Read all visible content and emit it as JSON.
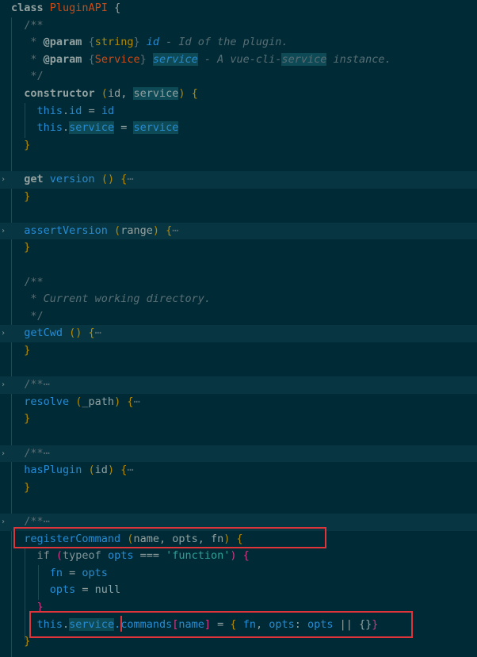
{
  "colors": {
    "default": "#93a1a1",
    "keyword": "#839496",
    "type": "#b58900",
    "function": "#268bd2",
    "comment": "#586e75",
    "string": "#2aa198",
    "paren": "#b58900",
    "bracket": "#d33682",
    "annotation": "#cb4b16",
    "match_bg": "#0e4a56",
    "fold_bg": "#073642",
    "red_box": "#e0343b"
  },
  "lines": [
    {
      "fold": false,
      "hl": false,
      "tokens": [
        {
          "t": "class ",
          "c": "default",
          "b": true
        },
        {
          "t": "PluginAPI",
          "c": "annotation"
        },
        {
          "t": " {",
          "c": "default"
        }
      ]
    },
    {
      "fold": false,
      "hl": false,
      "tokens": [
        {
          "t": "  /**",
          "c": "comment"
        }
      ]
    },
    {
      "fold": false,
      "hl": false,
      "tokens": [
        {
          "t": "   * ",
          "c": "comment"
        },
        {
          "t": "@param",
          "c": "default",
          "b": true
        },
        {
          "t": " {",
          "c": "comment"
        },
        {
          "t": "string",
          "c": "type"
        },
        {
          "t": "} ",
          "c": "comment"
        },
        {
          "t": "id",
          "c": "function",
          "i": true
        },
        {
          "t": " - Id of the plugin.",
          "c": "comment",
          "i": true
        }
      ]
    },
    {
      "fold": false,
      "hl": false,
      "tokens": [
        {
          "t": "   * ",
          "c": "comment"
        },
        {
          "t": "@param",
          "c": "default",
          "b": true
        },
        {
          "t": " {",
          "c": "comment"
        },
        {
          "t": "Service",
          "c": "annotation"
        },
        {
          "t": "} ",
          "c": "comment"
        },
        {
          "t": "service",
          "c": "function",
          "i": true,
          "m": true
        },
        {
          "t": " - A vue-cli-",
          "c": "comment",
          "i": true
        },
        {
          "t": "service",
          "c": "comment",
          "i": true,
          "m": true
        },
        {
          "t": " instance.",
          "c": "comment",
          "i": true
        }
      ]
    },
    {
      "fold": false,
      "hl": false,
      "tokens": [
        {
          "t": "   */",
          "c": "comment"
        }
      ]
    },
    {
      "fold": false,
      "hl": false,
      "tokens": [
        {
          "t": "  constructor",
          "c": "default",
          "b": true
        },
        {
          "t": " (",
          "c": "paren"
        },
        {
          "t": "id",
          "c": "default"
        },
        {
          "t": ", ",
          "c": "default"
        },
        {
          "t": "service",
          "c": "default",
          "m": true
        },
        {
          "t": ") {",
          "c": "paren"
        }
      ]
    },
    {
      "fold": false,
      "hl": false,
      "tokens": [
        {
          "t": "    this",
          "c": "function"
        },
        {
          "t": ".",
          "c": "default"
        },
        {
          "t": "id",
          "c": "function"
        },
        {
          "t": " = ",
          "c": "default"
        },
        {
          "t": "id",
          "c": "function"
        }
      ]
    },
    {
      "fold": false,
      "hl": false,
      "tokens": [
        {
          "t": "    this",
          "c": "function"
        },
        {
          "t": ".",
          "c": "default"
        },
        {
          "t": "service",
          "c": "function",
          "m": true
        },
        {
          "t": " = ",
          "c": "default"
        },
        {
          "t": "service",
          "c": "function",
          "m": true
        }
      ]
    },
    {
      "fold": false,
      "hl": false,
      "tokens": [
        {
          "t": "  }",
          "c": "paren"
        }
      ]
    },
    {
      "fold": false,
      "hl": false,
      "tokens": []
    },
    {
      "fold": true,
      "hl": true,
      "tokens": [
        {
          "t": "  get ",
          "c": "default",
          "b": true
        },
        {
          "t": "version",
          "c": "function"
        },
        {
          "t": " () {",
          "c": "paren"
        },
        {
          "t": "⋯",
          "c": "comment"
        }
      ]
    },
    {
      "fold": false,
      "hl": false,
      "tokens": [
        {
          "t": "  }",
          "c": "paren"
        }
      ]
    },
    {
      "fold": false,
      "hl": false,
      "tokens": []
    },
    {
      "fold": true,
      "hl": true,
      "tokens": [
        {
          "t": "  assertVersion",
          "c": "function"
        },
        {
          "t": " (",
          "c": "paren"
        },
        {
          "t": "range",
          "c": "default"
        },
        {
          "t": ") {",
          "c": "paren"
        },
        {
          "t": "⋯",
          "c": "comment"
        }
      ]
    },
    {
      "fold": false,
      "hl": false,
      "tokens": [
        {
          "t": "  }",
          "c": "paren"
        }
      ]
    },
    {
      "fold": false,
      "hl": false,
      "tokens": []
    },
    {
      "fold": false,
      "hl": false,
      "tokens": [
        {
          "t": "  /**",
          "c": "comment"
        }
      ]
    },
    {
      "fold": false,
      "hl": false,
      "tokens": [
        {
          "t": "   * Current working directory.",
          "c": "comment",
          "i": true
        }
      ]
    },
    {
      "fold": false,
      "hl": false,
      "tokens": [
        {
          "t": "   */",
          "c": "comment"
        }
      ]
    },
    {
      "fold": true,
      "hl": true,
      "tokens": [
        {
          "t": "  getCwd",
          "c": "function"
        },
        {
          "t": " () {",
          "c": "paren"
        },
        {
          "t": "⋯",
          "c": "comment"
        }
      ]
    },
    {
      "fold": false,
      "hl": false,
      "tokens": [
        {
          "t": "  }",
          "c": "paren"
        }
      ]
    },
    {
      "fold": false,
      "hl": false,
      "tokens": []
    },
    {
      "fold": true,
      "hl": true,
      "tokens": [
        {
          "t": "  /**",
          "c": "comment"
        },
        {
          "t": "⋯",
          "c": "comment"
        }
      ]
    },
    {
      "fold": false,
      "hl": false,
      "tokens": [
        {
          "t": "  resolve",
          "c": "function"
        },
        {
          "t": " (",
          "c": "paren"
        },
        {
          "t": "_path",
          "c": "default"
        },
        {
          "t": ") {",
          "c": "paren"
        },
        {
          "t": "⋯",
          "c": "comment"
        }
      ]
    },
    {
      "fold": false,
      "hl": false,
      "tokens": [
        {
          "t": "  }",
          "c": "paren"
        }
      ]
    },
    {
      "fold": false,
      "hl": false,
      "tokens": []
    },
    {
      "fold": true,
      "hl": true,
      "tokens": [
        {
          "t": "  /**",
          "c": "comment"
        },
        {
          "t": "⋯",
          "c": "comment"
        }
      ]
    },
    {
      "fold": false,
      "hl": false,
      "tokens": [
        {
          "t": "  hasPlugin",
          "c": "function"
        },
        {
          "t": " (",
          "c": "paren"
        },
        {
          "t": "id",
          "c": "default"
        },
        {
          "t": ") {",
          "c": "paren"
        },
        {
          "t": "⋯",
          "c": "comment"
        }
      ]
    },
    {
      "fold": false,
      "hl": false,
      "tokens": [
        {
          "t": "  }",
          "c": "paren"
        }
      ]
    },
    {
      "fold": false,
      "hl": false,
      "tokens": []
    },
    {
      "fold": true,
      "hl": true,
      "tokens": [
        {
          "t": "  /**",
          "c": "comment"
        },
        {
          "t": "⋯",
          "c": "comment"
        }
      ]
    },
    {
      "fold": false,
      "hl": false,
      "tokens": [
        {
          "t": "  registerCommand",
          "c": "function"
        },
        {
          "t": " (",
          "c": "paren"
        },
        {
          "t": "name",
          "c": "default"
        },
        {
          "t": ", ",
          "c": "default"
        },
        {
          "t": "opts",
          "c": "default"
        },
        {
          "t": ", ",
          "c": "default"
        },
        {
          "t": "fn",
          "c": "default"
        },
        {
          "t": ") {",
          "c": "paren"
        }
      ]
    },
    {
      "fold": false,
      "hl": false,
      "tokens": [
        {
          "t": "    if ",
          "c": "keyword"
        },
        {
          "t": "(",
          "c": "bracket"
        },
        {
          "t": "typeof ",
          "c": "keyword"
        },
        {
          "t": "opts",
          "c": "function"
        },
        {
          "t": " === ",
          "c": "default"
        },
        {
          "t": "'function'",
          "c": "string"
        },
        {
          "t": ") {",
          "c": "bracket"
        }
      ]
    },
    {
      "fold": false,
      "hl": false,
      "tokens": [
        {
          "t": "      fn",
          "c": "function"
        },
        {
          "t": " = ",
          "c": "default"
        },
        {
          "t": "opts",
          "c": "function"
        }
      ]
    },
    {
      "fold": false,
      "hl": false,
      "tokens": [
        {
          "t": "      opts",
          "c": "function"
        },
        {
          "t": " = ",
          "c": "default"
        },
        {
          "t": "null",
          "c": "default"
        }
      ]
    },
    {
      "fold": false,
      "hl": false,
      "tokens": [
        {
          "t": "    }",
          "c": "bracket"
        }
      ]
    },
    {
      "fold": false,
      "hl": false,
      "tokens": [
        {
          "t": "    this",
          "c": "function"
        },
        {
          "t": ".",
          "c": "default"
        },
        {
          "t": "service",
          "c": "function",
          "m": true
        },
        {
          "t": ".commands",
          "c": "function"
        },
        {
          "t": "[",
          "c": "bracket"
        },
        {
          "t": "name",
          "c": "function"
        },
        {
          "t": "]",
          "c": "bracket"
        },
        {
          "t": " = ",
          "c": "default"
        },
        {
          "t": "{ ",
          "c": "paren"
        },
        {
          "t": "fn",
          "c": "function"
        },
        {
          "t": ", ",
          "c": "default"
        },
        {
          "t": "opts",
          "c": "function"
        },
        {
          "t": ": ",
          "c": "default"
        },
        {
          "t": "opts",
          "c": "function"
        },
        {
          "t": " || ",
          "c": "default"
        },
        {
          "t": "{}",
          "c": "default"
        },
        {
          "t": "}",
          "c": "bracket"
        }
      ]
    },
    {
      "fold": false,
      "hl": false,
      "tokens": [
        {
          "t": "  }",
          "c": "paren"
        }
      ]
    }
  ]
}
